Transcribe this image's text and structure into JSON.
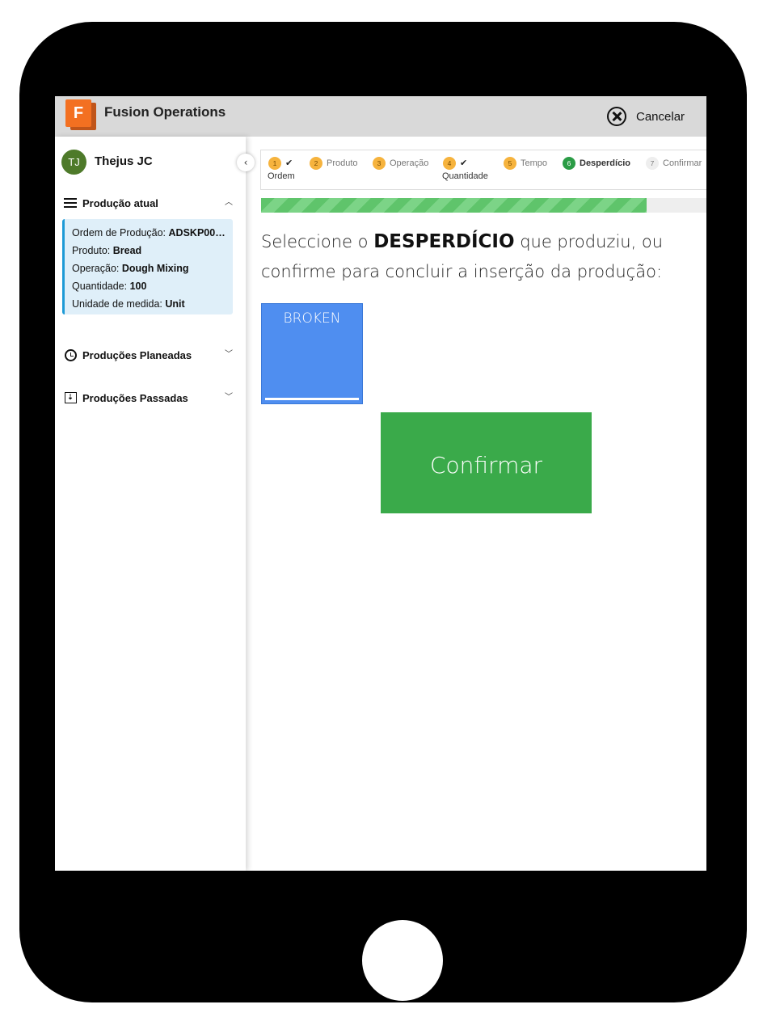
{
  "header": {
    "logo_letter": "F",
    "app_title": "Fusion Operations",
    "cancel_label": "Cancelar"
  },
  "sidebar": {
    "user": {
      "initials": "TJ",
      "name": "Thejus JC"
    },
    "current_section": {
      "title": "Produção atual"
    },
    "current": {
      "order_label": "Ordem de Produção:",
      "order_value": "ADSKP00…",
      "product_label": "Produto:",
      "product_value": "Bread",
      "operation_label": "Operação:",
      "operation_value": "Dough Mixing",
      "quantity_label": "Quantidade:",
      "quantity_value": "100",
      "unit_label": "Unidade de medida:",
      "unit_value": "Unit"
    },
    "planned_section": {
      "title": "Produções Planeadas"
    },
    "past_section": {
      "title": "Produções Passadas"
    }
  },
  "stepper": {
    "steps": [
      {
        "num": "1",
        "label": "Ordem",
        "done": true
      },
      {
        "num": "2",
        "label": "Produto"
      },
      {
        "num": "3",
        "label": "Operação"
      },
      {
        "num": "4",
        "label": "Quantidade",
        "done": true
      },
      {
        "num": "5",
        "label": "Tempo"
      },
      {
        "num": "6",
        "label": "Desperdício",
        "active": true
      },
      {
        "num": "7",
        "label": "Confirmar"
      }
    ],
    "progress_fraction": 0.865
  },
  "main": {
    "prompt_before": "Seleccione o ",
    "prompt_highlight": "DESPERDÍCIO",
    "prompt_after": " que produziu, ou confirme para concluir a inserção da produção:",
    "waste_options": [
      {
        "label": "BROKEN"
      }
    ],
    "confirm_label": "Confirmar"
  },
  "colors": {
    "accent_blue": "#4f8ef0",
    "confirm_green": "#3aaa4a",
    "step_done": "#f6b33d",
    "step_active": "#2b9c46",
    "brand_orange": "#f37021"
  }
}
